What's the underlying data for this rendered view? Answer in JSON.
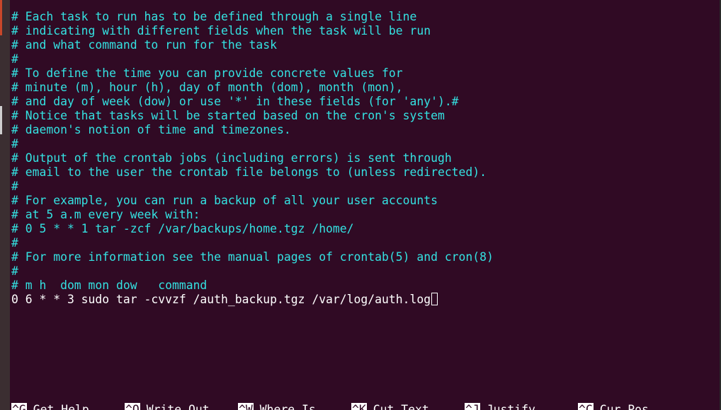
{
  "editor": {
    "lines": [
      "# Each task to run has to be defined through a single line",
      "# indicating with different fields when the task will be run",
      "# and what command to run for the task",
      "#",
      "# To define the time you can provide concrete values for",
      "# minute (m), hour (h), day of month (dom), month (mon),",
      "# and day of week (dow) or use '*' in these fields (for 'any').#",
      "# Notice that tasks will be started based on the cron's system",
      "# daemon's notion of time and timezones.",
      "#",
      "# Output of the crontab jobs (including errors) is sent through",
      "# email to the user the crontab file belongs to (unless redirected).",
      "#",
      "# For example, you can run a backup of all your user accounts",
      "# at 5 a.m every week with:",
      "# 0 5 * * 1 tar -zcf /var/backups/home.tgz /home/",
      "#",
      "# For more information see the manual pages of crontab(5) and cron(8)",
      "#",
      "# m h  dom mon dow   command"
    ],
    "entry_line": "0 6 * * 3 sudo tar -cvvzf /auth_backup.tgz /var/log/auth.log"
  },
  "shortcuts": [
    {
      "key": "^G",
      "label": "Get Help"
    },
    {
      "key": "^O",
      "label": "Write Out"
    },
    {
      "key": "^W",
      "label": "Where Is"
    },
    {
      "key": "^K",
      "label": "Cut Text"
    },
    {
      "key": "^J",
      "label": "Justify"
    },
    {
      "key": "^C",
      "label": "Cur Pos"
    }
  ],
  "colors": {
    "background": "#300a24",
    "comment": "#34e2e2",
    "text": "#ffffff"
  }
}
